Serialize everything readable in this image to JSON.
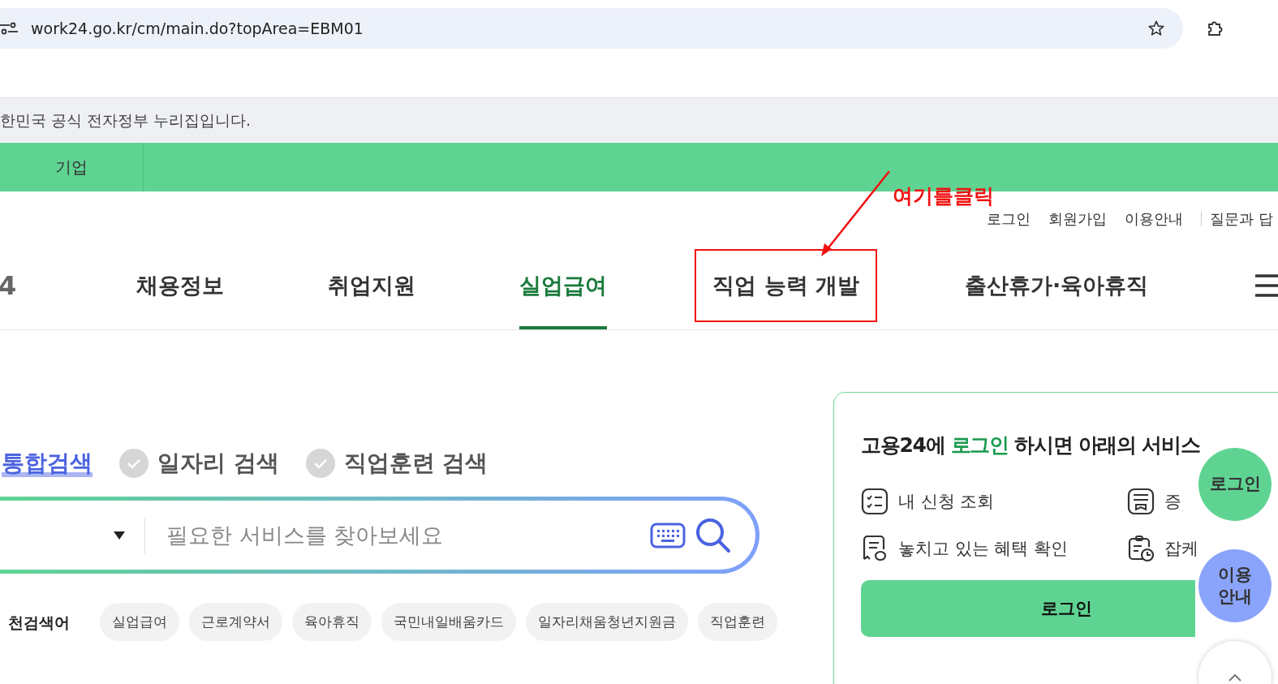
{
  "browser": {
    "url": "work24.go.kr/cm/main.do?topArea=EBM01"
  },
  "gov_banner": "한민국 공식 전자정부 누리집입니다.",
  "audience_tabs": [
    {
      "label": "기업",
      "selected": false
    }
  ],
  "utility_links": [
    "로그인",
    "회원가입",
    "이용안내",
    "질문과 답"
  ],
  "logo_fragment": "4",
  "nav": [
    {
      "label": "채용정보",
      "selected": false,
      "highlighted": false
    },
    {
      "label": "취업지원",
      "selected": false,
      "highlighted": false
    },
    {
      "label": "실업급여",
      "selected": true,
      "highlighted": false
    },
    {
      "label": "직업 능력 개발",
      "selected": false,
      "highlighted": true
    },
    {
      "label": "출산휴가·육아휴직",
      "selected": false,
      "highlighted": false
    }
  ],
  "annotation": {
    "text": "여기를클릭"
  },
  "search_tabs": [
    {
      "label": "통합검색",
      "selected": true
    },
    {
      "label": "일자리 검색",
      "selected": false
    },
    {
      "label": "직업훈련 검색",
      "selected": false
    }
  ],
  "search": {
    "placeholder": "필요한 서비스를 찾아보세요"
  },
  "recommended": {
    "label": "천검색어",
    "tags": [
      "실업급여",
      "근로계약서",
      "육아휴직",
      "국민내일배움카드",
      "일자리채움청년지원금",
      "직업훈련"
    ]
  },
  "login_card": {
    "before": "고용24에 ",
    "highlight": "로그인",
    "after": " 하시면 아래의 서비스",
    "services": [
      {
        "kind": "checklist",
        "label": "내 신청 조회"
      },
      {
        "kind": "document",
        "label": "증"
      },
      {
        "kind": "receipt",
        "label": "놓치고 있는 혜택 확인"
      },
      {
        "kind": "clipboard",
        "label": "잡케"
      }
    ],
    "button": "로그인"
  },
  "floating": [
    {
      "kind": "login",
      "label": "로그인"
    },
    {
      "kind": "guide",
      "label": "이용\n안내"
    },
    {
      "kind": "top"
    }
  ]
}
